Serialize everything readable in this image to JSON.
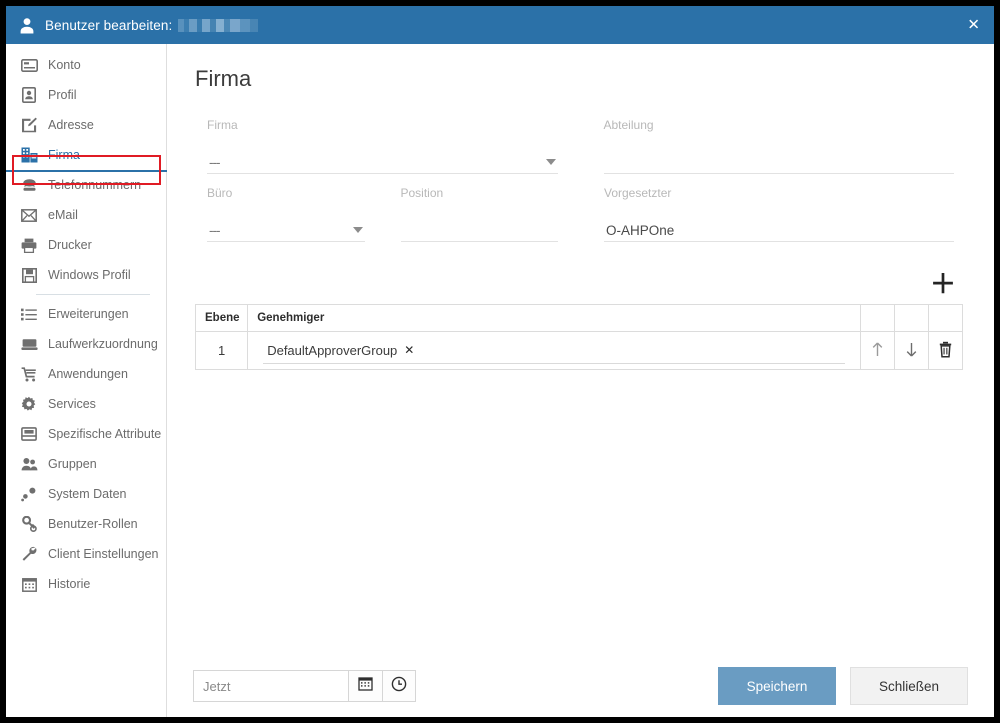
{
  "titlebar": {
    "icon": "user-icon",
    "label": "Benutzer bearbeiten:",
    "redacted_value": "",
    "close_label": "✕",
    "bg_color": "#2b71a8"
  },
  "sidebar": {
    "items": [
      {
        "label": "Konto",
        "icon": "card-icon",
        "active": false
      },
      {
        "label": "Profil",
        "icon": "id-badge-icon",
        "active": false
      },
      {
        "label": "Adresse",
        "icon": "edit-note-icon",
        "active": false
      },
      {
        "label": "Firma",
        "icon": "building-icon",
        "active": true
      },
      {
        "label": "Telefonnummern",
        "icon": "phone-icon",
        "active": false
      },
      {
        "label": "eMail",
        "icon": "envelope-icon",
        "active": false
      },
      {
        "label": "Drucker",
        "icon": "printer-icon",
        "active": false
      },
      {
        "label": "Windows Profil",
        "icon": "floppy-disk-icon",
        "active": false
      },
      {
        "label": "Erweiterungen",
        "icon": "list-icon",
        "active": false
      },
      {
        "label": "Laufwerkzuordnung",
        "icon": "drive-icon",
        "active": false
      },
      {
        "label": "Anwendungen",
        "icon": "cart-icon",
        "active": false
      },
      {
        "label": "Services",
        "icon": "gear-icon",
        "active": false
      },
      {
        "label": "Spezifische Attribute",
        "icon": "inbox-icon",
        "active": false
      },
      {
        "label": "Gruppen",
        "icon": "people-icon",
        "active": false
      },
      {
        "label": "System Daten",
        "icon": "nodes-icon",
        "active": false
      },
      {
        "label": "Benutzer-Rollen",
        "icon": "key-person-icon",
        "active": false
      },
      {
        "label": "Client Einstellungen",
        "icon": "wrench-icon",
        "active": false
      },
      {
        "label": "Historie",
        "icon": "calendar-icon",
        "active": false
      }
    ],
    "active_highlight_color": "#2b71a8",
    "annotation_color": "#e01b24"
  },
  "main": {
    "page_title": "Firma",
    "fields": {
      "firma": {
        "label": "Firma",
        "value": "---",
        "type": "select"
      },
      "abteilung": {
        "label": "Abteilung",
        "value": "",
        "type": "text"
      },
      "buero": {
        "label": "Büro",
        "value": "---",
        "type": "select"
      },
      "position": {
        "label": "Position",
        "value": "",
        "type": "text"
      },
      "vorgesetzter": {
        "label": "Vorgesetzter",
        "value": "O-AHPOne",
        "type": "text"
      }
    },
    "add_button_label": "＋",
    "table": {
      "headers": [
        "Ebene",
        "Genehmiger",
        "",
        "",
        ""
      ],
      "rows": [
        {
          "ebene": "1",
          "genehmiger": "DefaultApproverGroup",
          "remove_label": "✕"
        }
      ],
      "actions": {
        "move_up": "move-up-icon",
        "move_down": "move-down-icon",
        "delete": "trash-icon"
      }
    }
  },
  "footer": {
    "date_placeholder": "Jetzt",
    "date_value": "",
    "calendar_icon": "calendar-icon",
    "clock_icon": "clock-icon",
    "save_label": "Speichern",
    "close_label": "Schließen",
    "save_color": "#6a9cc2"
  }
}
